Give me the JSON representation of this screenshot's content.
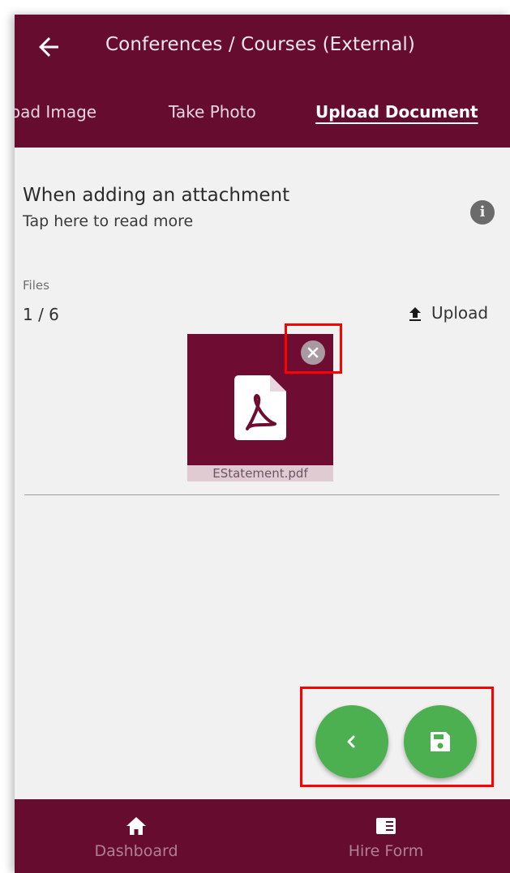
{
  "header": {
    "title": "Conferences / Courses (External)",
    "back_icon": "arrow-left-icon"
  },
  "tabs": [
    {
      "label": "Upload Image",
      "active": false
    },
    {
      "label": "Take Photo",
      "active": false
    },
    {
      "label": "Upload Document",
      "active": true
    }
  ],
  "info": {
    "title": "When adding an attachment",
    "subtitle": "Tap here to read more",
    "icon": "info-icon",
    "icon_glyph": "i"
  },
  "files": {
    "label": "Files",
    "count": "1 / 6",
    "upload_label": "Upload",
    "upload_icon": "upload-icon",
    "items": [
      {
        "name": "EStatement.pdf",
        "icon": "pdf-file-icon"
      }
    ]
  },
  "actions": {
    "previous_icon": "chevron-left-icon",
    "save_icon": "save-icon"
  },
  "bottom_nav": [
    {
      "label": "Dashboard",
      "icon": "home-icon"
    },
    {
      "label": "Hire Form",
      "icon": "form-icon"
    }
  ],
  "colors": {
    "brand": "#660d2f",
    "card": "#6e0d31",
    "fab": "#4caf50",
    "background": "#f2f1f1",
    "highlight": "#ff0000"
  }
}
